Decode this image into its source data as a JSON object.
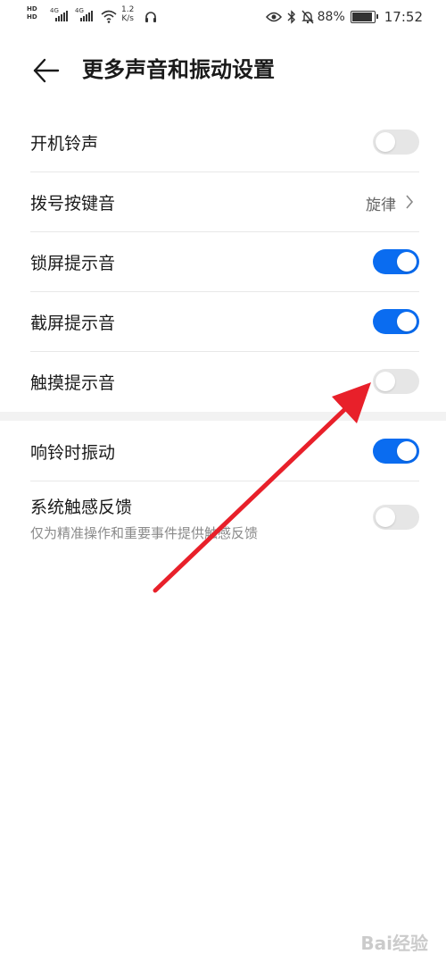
{
  "status_bar": {
    "hd1": "HD",
    "hd2": "HD",
    "net1": "4G",
    "net2": "4G",
    "net_speed_value": "1.2",
    "net_speed_unit": "K/s",
    "battery": "88%",
    "time": "17:52",
    "icons": [
      "eye-icon",
      "bluetooth-icon",
      "bell-off-icon",
      "battery-icon",
      "headset-icon",
      "wifi-icon"
    ]
  },
  "header": {
    "back_icon": "arrow-left-icon",
    "title": "更多声音和振动设置"
  },
  "settings": {
    "boot_ringtone": {
      "label": "开机铃声",
      "enabled": false
    },
    "dial_pad_tone": {
      "label": "拨号按键音",
      "value": "旋律"
    },
    "lock_screen_tone": {
      "label": "锁屏提示音",
      "enabled": true
    },
    "screenshot_tone": {
      "label": "截屏提示音",
      "enabled": true
    },
    "touch_tone": {
      "label": "触摸提示音",
      "enabled": false
    },
    "vibrate_on_ring": {
      "label": "响铃时振动",
      "enabled": true
    },
    "haptic_feedback": {
      "label": "系统触感反馈",
      "sub": "仅为精准操作和重要事件提供触感反馈",
      "enabled": false
    }
  },
  "colors": {
    "switch_on": "#0a6cf0",
    "switch_off": "#e6e6e6",
    "annotation_arrow": "#e8202a"
  },
  "watermark": "Bai经验"
}
